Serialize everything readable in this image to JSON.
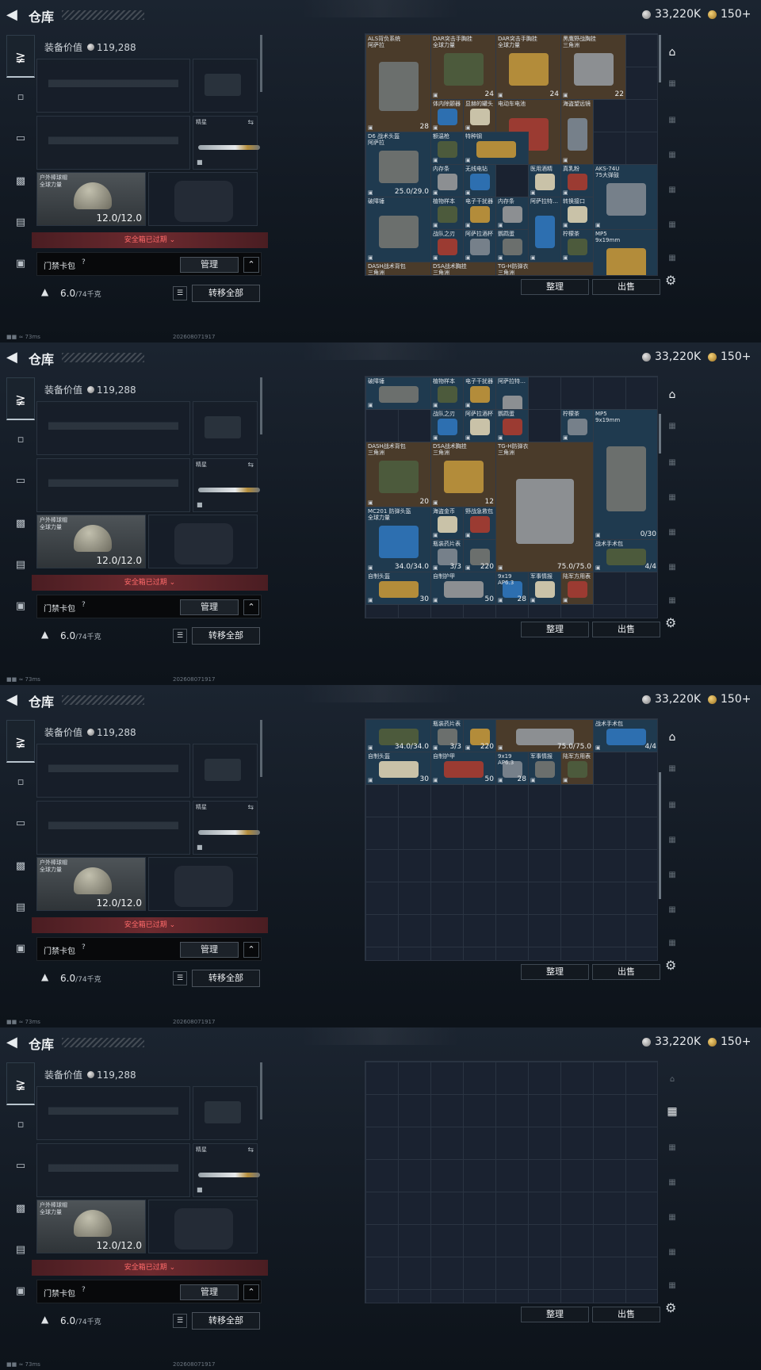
{
  "header": {
    "title": "仓库",
    "currency_silver": "33,220K",
    "currency_gold": "150+"
  },
  "equipment": {
    "value_label": "装备价值",
    "value": "119,288",
    "melee_label": "精星",
    "helmet_name": "户外棒球帽\n全球力量",
    "helmet_durability": "12.0/12.0",
    "safe_box_expired": "安全箱已过期",
    "keycard_label": "门禁卡包",
    "help": "?",
    "manage_label": "管理",
    "weight": "6.0",
    "weight_unit": "/74千克",
    "transfer_all_label": "转移全部"
  },
  "status": {
    "ping": "73ms",
    "timestamp": "202608071917"
  },
  "stash": {
    "sort_label": "整理",
    "sell_label": "出售",
    "frames": [
      {
        "items": [
          {
            "name": "ALS背负系统\n阿萨拉",
            "count": "28",
            "bg": "bg-brown"
          },
          {
            "name": "DAR突击手胸挂\n全球力量",
            "count": "24",
            "bg": "bg-brown"
          },
          {
            "name": "DAR突击手胸挂\n全球力量",
            "count": "24",
            "bg": "bg-brown"
          },
          {
            "name": "黑鹰野战胸挂\n三角洲",
            "count": "22",
            "bg": "bg-brown"
          },
          {
            "name": "体内除颤器",
            "count": "",
            "bg": "bg-brown"
          },
          {
            "name": "显赫的罐头",
            "count": "",
            "bg": "bg-brown"
          },
          {
            "name": "电动车电池",
            "count": "",
            "bg": "bg-brown"
          },
          {
            "name": "海盗望远镜",
            "count": "",
            "bg": "bg-brown"
          },
          {
            "name": "D6 战术头盔\n阿萨拉",
            "count": "25.0/29.0",
            "bg": "bg-blue"
          },
          {
            "name": "额温枪",
            "count": "",
            "bg": "bg-blue"
          },
          {
            "name": "特种钢",
            "count": "",
            "bg": "bg-blue"
          },
          {
            "name": "内存条",
            "count": "",
            "bg": "bg-blue"
          },
          {
            "name": "无线电钻",
            "count": "",
            "bg": "bg-blue"
          },
          {
            "name": "医用酒精",
            "count": "",
            "bg": "bg-blue"
          },
          {
            "name": "真乳粉",
            "count": "",
            "bg": "bg-blue"
          },
          {
            "name": "AKS-74U\n75大弹鼓",
            "count": "",
            "bg": "bg-blue"
          },
          {
            "name": "破障锤",
            "count": "",
            "bg": "bg-blue"
          },
          {
            "name": "植物样本",
            "count": "",
            "bg": "bg-blue"
          },
          {
            "name": "电子干扰器",
            "count": "",
            "bg": "bg-blue"
          },
          {
            "name": "内存条",
            "count": "",
            "bg": "bg-blue"
          },
          {
            "name": "阿萨拉特…",
            "count": "",
            "bg": "bg-blue"
          },
          {
            "name": "转换接口",
            "count": "",
            "bg": "bg-blue"
          },
          {
            "name": "战队之刃",
            "count": "",
            "bg": "bg-blue"
          },
          {
            "name": "阿萨拉酒杯",
            "count": "",
            "bg": "bg-blue"
          },
          {
            "name": "鹦鹉蛋",
            "count": "",
            "bg": "bg-blue"
          },
          {
            "name": "柠檬茶",
            "count": "",
            "bg": "bg-blue"
          },
          {
            "name": "MP5\n9x19mm",
            "count": "",
            "bg": "bg-blue"
          },
          {
            "name": "DASH战术背包\n三角洲",
            "count": "",
            "bg": "bg-brown"
          },
          {
            "name": "DSA战术胸挂\n三角洲",
            "count": "",
            "bg": "bg-brown"
          },
          {
            "name": "TG-H防弹衣\n三角洲",
            "count": "",
            "bg": "bg-brown"
          }
        ]
      },
      {
        "items": [
          {
            "name": "破障锤",
            "count": "",
            "bg": "bg-blue"
          },
          {
            "name": "植物样本",
            "count": "",
            "bg": "bg-blue"
          },
          {
            "name": "电子干扰器",
            "count": "",
            "bg": "bg-blue"
          },
          {
            "name": "阿萨拉特…",
            "count": "",
            "bg": "bg-blue"
          },
          {
            "name": "战队之刃",
            "count": "",
            "bg": "bg-blue"
          },
          {
            "name": "阿萨拉酒杯",
            "count": "",
            "bg": "bg-blue"
          },
          {
            "name": "鹦鹉蛋",
            "count": "",
            "bg": "bg-blue"
          },
          {
            "name": "柠檬茶",
            "count": "",
            "bg": "bg-blue"
          },
          {
            "name": "MP5\n9x19mm",
            "count": "0/30",
            "bg": "bg-blue"
          },
          {
            "name": "DASH战术背包\n三角洲",
            "count": "20",
            "bg": "bg-brown"
          },
          {
            "name": "DSA战术胸挂\n三角洲",
            "count": "12",
            "bg": "bg-brown"
          },
          {
            "name": "TG-H防弹衣\n三角洲",
            "count": "75.0/75.0",
            "bg": "bg-brown"
          },
          {
            "name": "MC201 防弹头盔\n全球力量",
            "count": "34.0/34.0",
            "bg": "bg-blue"
          },
          {
            "name": "海盗金币",
            "count": "",
            "bg": "bg-blue"
          },
          {
            "name": "野战急救包",
            "count": "",
            "bg": "bg-blue"
          },
          {
            "name": "瓶装药片表",
            "count": "3/3",
            "bg": "bg-blue"
          },
          {
            "name": "",
            "count": "220",
            "bg": "bg-blue"
          },
          {
            "name": "战术手术包",
            "count": "4/4",
            "bg": "bg-blue"
          },
          {
            "name": "自制头盔",
            "count": "30",
            "bg": "bg-blue"
          },
          {
            "name": "自制护甲",
            "count": "50",
            "bg": "bg-blue"
          },
          {
            "name": "9x19\nAP6.3",
            "count": "28",
            "bg": "bg-blue"
          },
          {
            "name": "军事情报",
            "count": "",
            "bg": "bg-blue"
          },
          {
            "name": "陆军方用表",
            "count": "",
            "bg": "bg-brown"
          }
        ]
      },
      {
        "items": [
          {
            "name": "瓶装药片表",
            "count": "3/3",
            "bg": "bg-blue"
          },
          {
            "name": "",
            "count": "34.0/34.0",
            "bg": "bg-blue"
          },
          {
            "name": "",
            "count": "220",
            "bg": "bg-blue"
          },
          {
            "name": "",
            "count": "75.0/75.0",
            "bg": "bg-brown"
          },
          {
            "name": "战术手术包",
            "count": "4/4",
            "bg": "bg-blue"
          },
          {
            "name": "自制头盔",
            "count": "30",
            "bg": "bg-blue"
          },
          {
            "name": "自制护甲",
            "count": "50",
            "bg": "bg-blue"
          },
          {
            "name": "9x19\nAP6.3",
            "count": "28",
            "bg": "bg-blue"
          },
          {
            "name": "军事情报",
            "count": "",
            "bg": "bg-blue"
          },
          {
            "name": "陆军方用表",
            "count": "",
            "bg": "bg-brown"
          }
        ]
      },
      {
        "items": []
      }
    ]
  }
}
